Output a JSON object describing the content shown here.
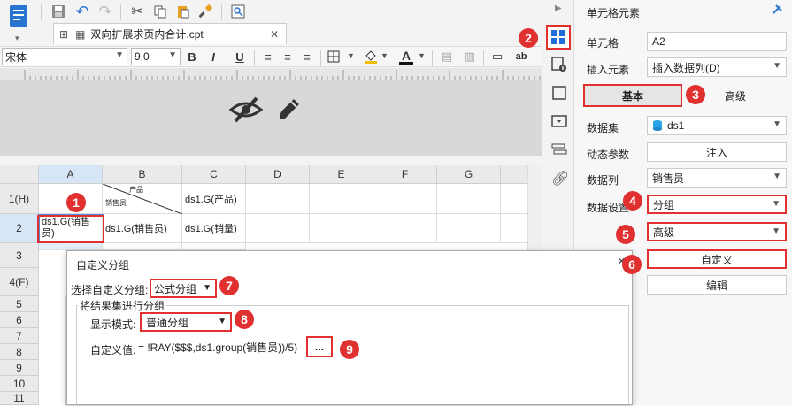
{
  "toolbar": {
    "file_tab": "双向扩展求页内合计.cpt"
  },
  "format": {
    "font_name": "宋体",
    "font_size": "9.0",
    "bold": "B",
    "italic": "I",
    "underline": "U",
    "ab": "ab"
  },
  "grid": {
    "columns": [
      "A",
      "B",
      "C",
      "D",
      "E",
      "F",
      "G"
    ],
    "rows": [
      "1(H)",
      "2",
      "3",
      "4(F)",
      "5",
      "6",
      "7",
      "8",
      "9",
      "10",
      "11"
    ],
    "cells": {
      "b1_top": "产品",
      "b1_bottom": "销售员",
      "c1": "ds1.G(产品)",
      "a2": "ds1.G(销售员)",
      "b2": "ds1.G(销售员)",
      "c2": "ds1.G(销量)"
    }
  },
  "panel": {
    "title": "单元格元素",
    "cell_label": "单元格",
    "cell_value": "A2",
    "insert_label": "插入元素",
    "insert_value": "插入数据列(D)",
    "tab_basic": "基本",
    "tab_advanced": "高级",
    "dataset_label": "数据集",
    "dataset_value": "ds1",
    "dynamic_label": "动态参数",
    "dynamic_button": "注入",
    "column_label": "数据列",
    "column_value": "销售员",
    "setting_label": "数据设置",
    "setting_value": "分组",
    "advanced_value": "高级",
    "custom_button": "自定义",
    "edit_button": "编辑"
  },
  "dialog": {
    "title": "自定义分组",
    "select_label": "选择自定义分组:",
    "select_value": "公式分组",
    "group_title": "将结果集进行分组",
    "mode_label": "显示模式:",
    "mode_value": "普通分组",
    "value_label": "自定义值:",
    "value_text": "= !RAY($$$,ds1.group(销售员))/5)",
    "more_button": "...",
    "close": "×"
  },
  "badges": [
    "1",
    "2",
    "3",
    "4",
    "5",
    "6",
    "7",
    "8",
    "9"
  ],
  "colors": {
    "accent": "#1e6fd9",
    "badge": "#e03030",
    "selected_col": "#d6e6f7"
  }
}
